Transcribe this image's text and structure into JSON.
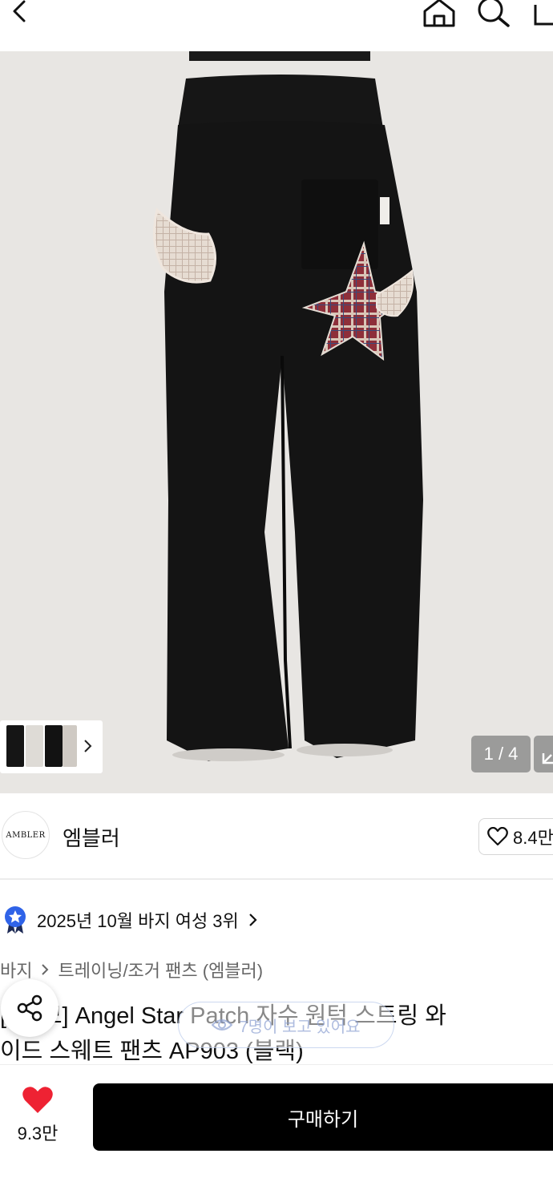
{
  "hero": {
    "counter": "1 / 4"
  },
  "brand": {
    "logo_text": "AMBLER",
    "name": "엠블러",
    "likes": "8.4만"
  },
  "ranking": {
    "text": "2025년 10월 바지 여성 3위"
  },
  "breadcrumb": {
    "items": [
      "바지",
      "트레이닝/조거 팬츠 (엠블러)"
    ]
  },
  "product": {
    "title_line1": "[   /기모] Angel Star Patch 자수 원턱 스트링 와",
    "title_line2": "이드 스웨트 팬츠 AP903 (블랙)"
  },
  "viewers": {
    "text": "7명이 보고 있어요"
  },
  "bottom": {
    "heart_count": "9.3만",
    "buy_label": "구매하기"
  },
  "colors": {
    "accent_red": "#ee2233",
    "rank_blue": "#2f63e8",
    "buy_bg": "#000000"
  }
}
